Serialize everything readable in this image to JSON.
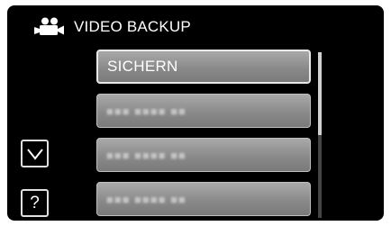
{
  "header": {
    "icon": "video-camera-icon",
    "title": "VIDEO BACKUP"
  },
  "menu": {
    "items": [
      {
        "label": "SICHERN",
        "selected": true
      },
      {
        "label": "■■■ ■■■■ ■■",
        "blurred": true
      },
      {
        "label": "■■■ ■■■■ ■■",
        "blurred": true
      },
      {
        "label": "■■■ ■■■■ ■■",
        "blurred": true
      }
    ],
    "scroll_fraction_visible": 0.5,
    "scroll_position": 0
  },
  "side_controls": {
    "down_icon": "chevron-down-icon",
    "help_label": "?"
  }
}
